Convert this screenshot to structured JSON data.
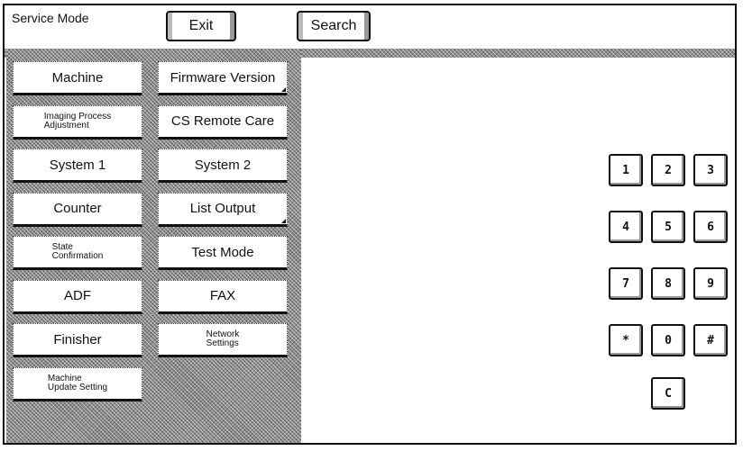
{
  "header": {
    "title": "Service Mode",
    "exit_label": "Exit",
    "search_label": "Search"
  },
  "menu": {
    "left": [
      {
        "label": "Machine",
        "size": "big"
      },
      {
        "label": "Imaging Process\nAdjustment",
        "size": "small"
      },
      {
        "label": "System 1",
        "size": "big"
      },
      {
        "label": "Counter",
        "size": "big"
      },
      {
        "label": "State\nConfirmation",
        "size": "small"
      },
      {
        "label": "ADF",
        "size": "big"
      },
      {
        "label": "Finisher",
        "size": "big"
      },
      {
        "label": "Machine\nUpdate Setting",
        "size": "small"
      }
    ],
    "right": [
      {
        "label": "Firmware Version",
        "size": "big",
        "submenu": true
      },
      {
        "label": "CS Remote Care",
        "size": "big"
      },
      {
        "label": "System 2",
        "size": "big"
      },
      {
        "label": "List Output",
        "size": "big",
        "submenu": true
      },
      {
        "label": "Test Mode",
        "size": "big"
      },
      {
        "label": "FAX",
        "size": "big"
      },
      {
        "label": "Network\nSettings",
        "size": "small"
      }
    ]
  },
  "keypad": {
    "keys": [
      "1",
      "2",
      "3",
      "4",
      "5",
      "6",
      "7",
      "8",
      "9",
      "*",
      "0",
      "#"
    ],
    "clear": "C"
  }
}
